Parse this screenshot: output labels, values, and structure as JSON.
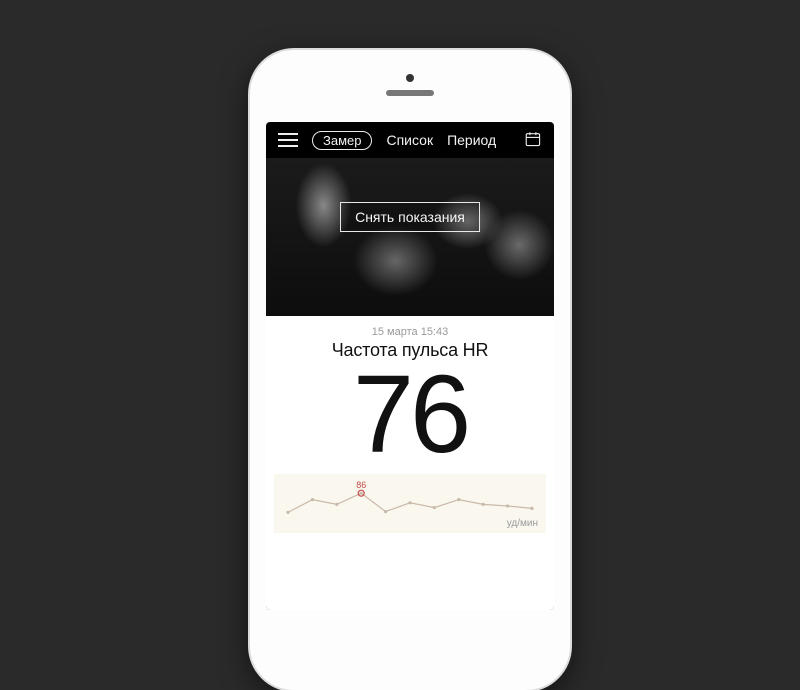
{
  "nav": {
    "tab_measure": "Замер",
    "tab_list": "Список",
    "tab_period": "Период"
  },
  "hero": {
    "cta_label": "Снять показания"
  },
  "reading": {
    "timestamp": "15 марта 15:43",
    "metric_title": "Частота пульса HR",
    "value": "76",
    "unit": "уд/мин"
  },
  "chart_data": {
    "type": "line",
    "title": "",
    "xlabel": "",
    "ylabel": "уд/мин",
    "ylim": [
      55,
      90
    ],
    "x": [
      0,
      1,
      2,
      3,
      4,
      5,
      6,
      7,
      8,
      9,
      10
    ],
    "values": [
      62,
      78,
      72,
      86,
      63,
      74,
      68,
      78,
      72,
      70,
      67
    ],
    "peak_label": "86",
    "peak_index": 3
  }
}
